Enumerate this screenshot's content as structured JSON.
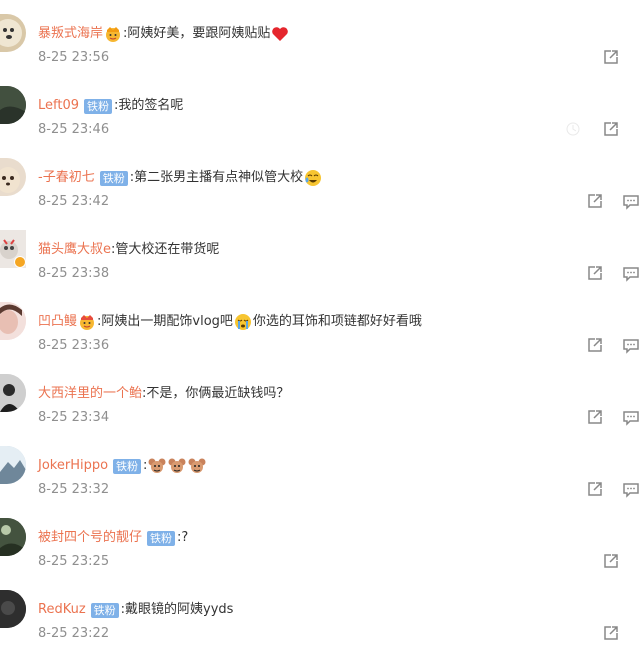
{
  "comments": [
    {
      "name": "暴叛式海岸",
      "fan_badge": "",
      "text": ":阿姨好美，要跟阿姨贴贴",
      "time": "8-25 23:56"
    },
    {
      "name": "Left09",
      "fan_badge": "铁粉",
      "text": ":我的签名呢",
      "time": "8-25 23:46"
    },
    {
      "name": "-子春初七",
      "fan_badge": "铁粉",
      "text": ":第二张男主播有点神似管大校",
      "time": "8-25 23:42"
    },
    {
      "name": "猫头鹰大叔e",
      "fan_badge": "",
      "text": ":管大校还在带货呢",
      "time": "8-25 23:38"
    },
    {
      "name": "凹凸鳗",
      "fan_badge": "",
      "text": ":阿姨出一期配饰vlog吧",
      "text2": "你选的耳饰和项链都好好看哦",
      "time": "8-25 23:36"
    },
    {
      "name": "大西洋里的一个鲐",
      "fan_badge": "",
      "text": ":不是，你俩最近缺钱吗？",
      "time": "8-25 23:34"
    },
    {
      "name": "JokerHippo",
      "fan_badge": "铁粉",
      "text": ":",
      "time": "8-25 23:32"
    },
    {
      "name": "被封四个号的靓仔",
      "fan_badge": "铁粉",
      "text": ":?",
      "time": "8-25 23:25"
    },
    {
      "name": "RedKuz",
      "fan_badge": "铁粉",
      "text": ":戴眼镜的阿姨yyds",
      "time": "8-25 23:22"
    }
  ],
  "colors": {
    "username": "#eb7350",
    "fan_badge_bg": "#7fb1e8",
    "time": "#8f8f8f"
  },
  "icons": [
    "share-icon",
    "comment-icon"
  ]
}
